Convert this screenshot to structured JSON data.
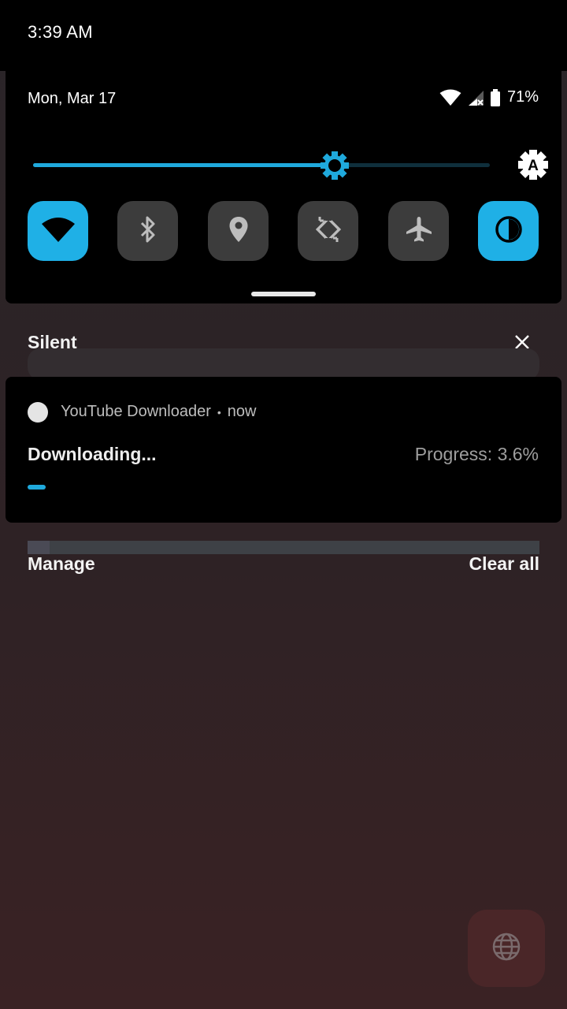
{
  "status_bar": {
    "time": "3:39 AM"
  },
  "quick_settings": {
    "date": "Mon, Mar 17",
    "battery_percent": "71%",
    "brightness_level": 0.66,
    "auto_brightness_label": "A",
    "tiles": [
      {
        "icon": "wifi-icon",
        "active": true
      },
      {
        "icon": "bluetooth-icon",
        "active": false
      },
      {
        "icon": "location-icon",
        "active": false
      },
      {
        "icon": "auto-rotate-icon",
        "active": false
      },
      {
        "icon": "airplane-icon",
        "active": false
      },
      {
        "icon": "dark-theme-icon",
        "active": true
      }
    ],
    "accent_color": "#1fb0e6"
  },
  "notifications": {
    "section_label": "Silent",
    "items": [
      {
        "app_name": "YouTube Downloader",
        "time": "now",
        "title": "Downloading...",
        "progress_text": "Progress: 3.6%",
        "progress_value": 0.036
      }
    ]
  },
  "footer": {
    "manage_label": "Manage",
    "clear_all_label": "Clear all"
  }
}
